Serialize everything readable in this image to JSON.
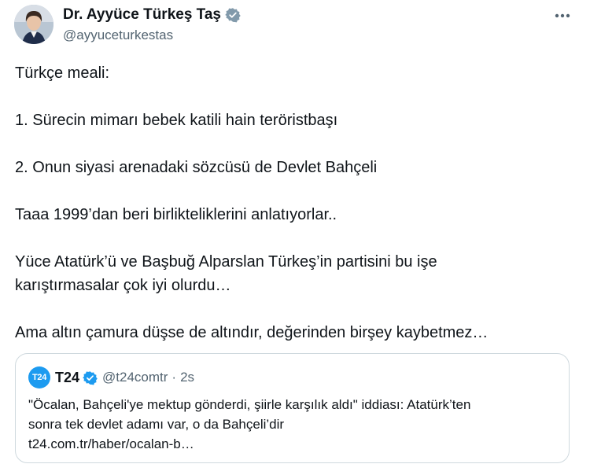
{
  "author": {
    "name": "Dr. Ayyüce Türkeş Taş",
    "handle": "@ayyuceturkestas",
    "verified_icon": "verified-badge-icon",
    "more_icon": "more-horizontal-icon"
  },
  "tweet": {
    "lines": [
      "Türkçe meali:",
      "1. Sürecin mimarı bebek katili hain teröristbaşı",
      "2. Onun siyasi arenadaki sözcüsü de Devlet Bahçeli",
      "Taaa 1999’dan beri birlikteliklerini anlatıyorlar..",
      "Yüce Atatürk’ü ve Başbuğ Alparslan Türkeş’in partisini bu işe",
      "karıştırmasalar çok iyi olurdu…",
      "Ama altın çamura düşse de altındır, değerinden birşey kaybetmez…"
    ]
  },
  "quote": {
    "logo_text": "T24",
    "name": "T24",
    "handle": "@t24comtr",
    "separator": "·",
    "time": "2s",
    "lines": [
      "\"Öcalan, Bahçeli'ye mektup gönderdi, şiirle karşılık aldı\" iddiası: Atatürk’ten",
      "sonra tek devlet adamı var, o da Bahçeli’dir",
      "t24.com.tr/haber/ocalan-b…"
    ]
  },
  "colors": {
    "text": "#0f1419",
    "secondary": "#536471",
    "accent": "#1d9bf0",
    "border": "#cfd9de"
  }
}
